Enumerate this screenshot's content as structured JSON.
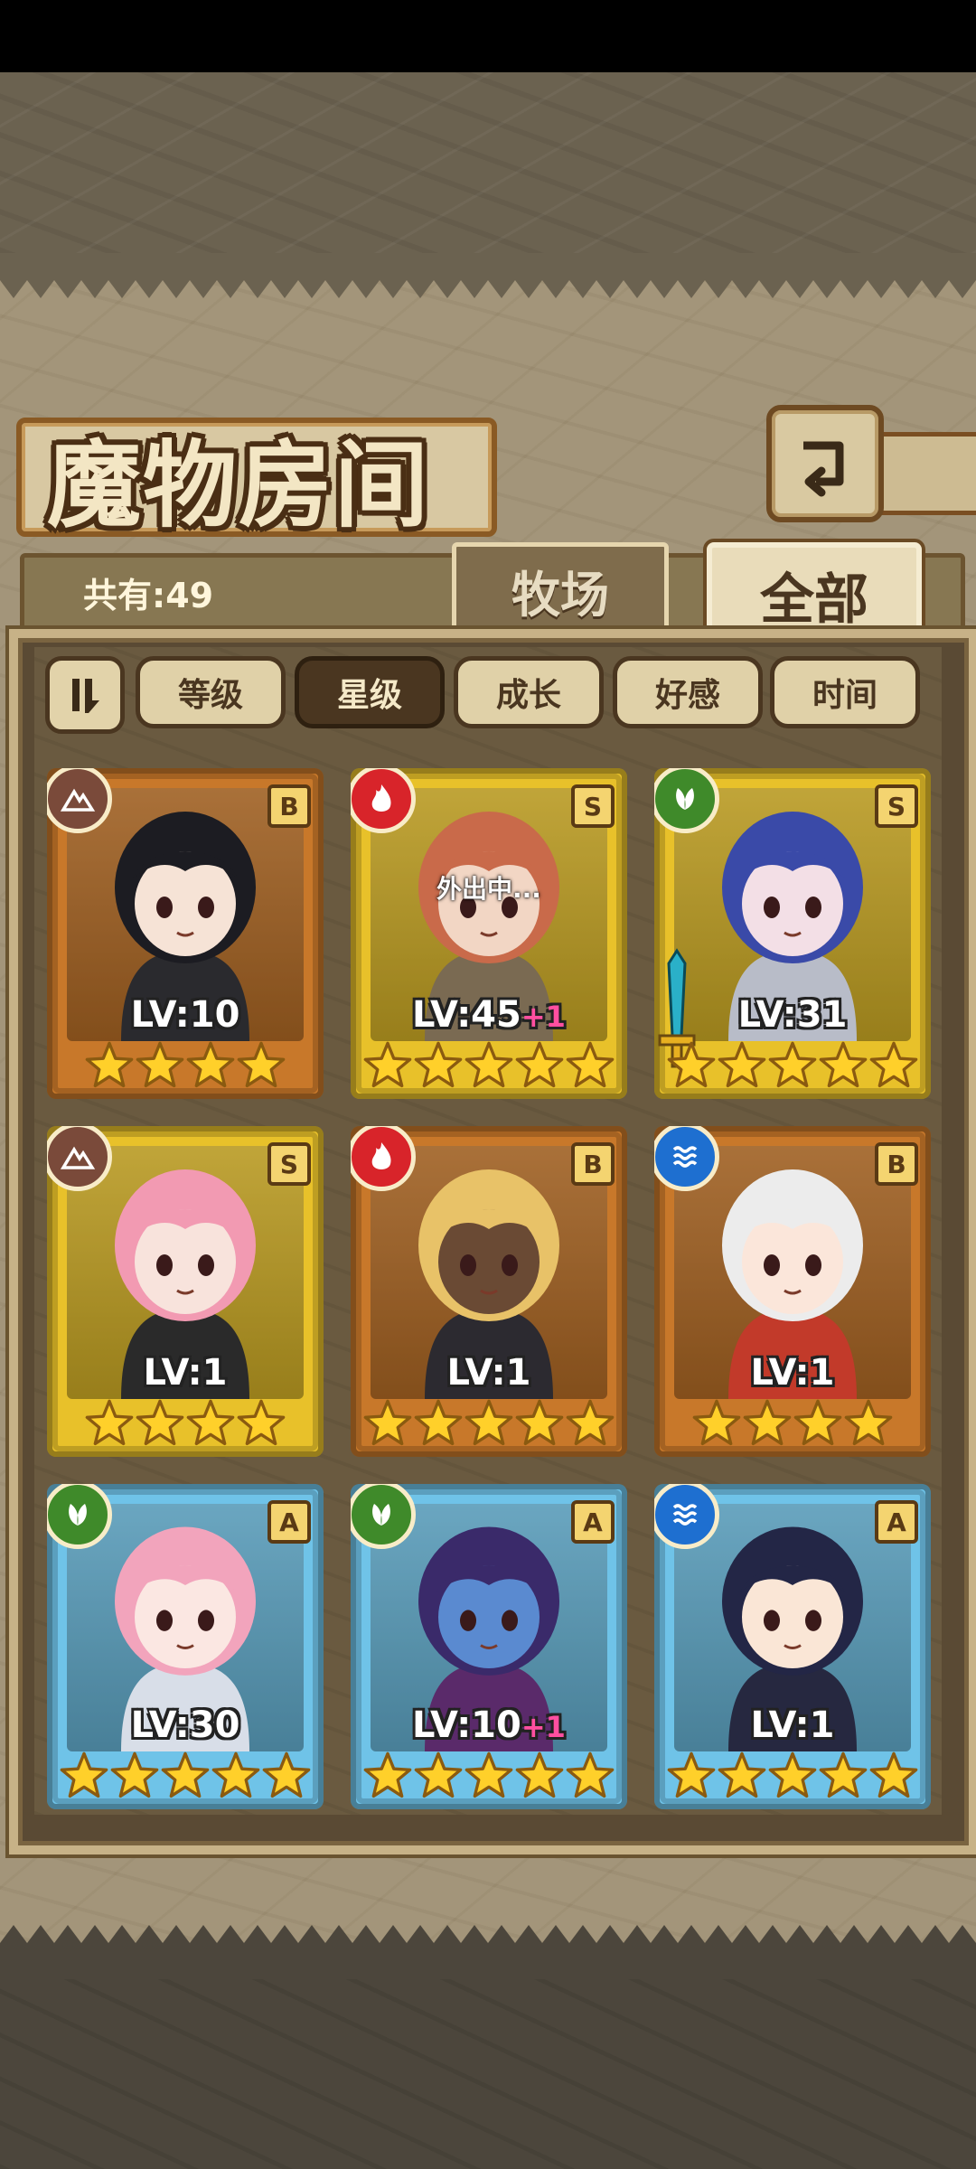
{
  "screen": {
    "title": "魔物房间",
    "count_label": "共有:49",
    "tabs": [
      {
        "label": "牧场",
        "active": false
      },
      {
        "label": "全部",
        "active": true
      }
    ],
    "sort_buttons": [
      {
        "label": "等级",
        "active": false
      },
      {
        "label": "星级",
        "active": true
      },
      {
        "label": "成长",
        "active": false
      },
      {
        "label": "好感",
        "active": false
      },
      {
        "label": "时间",
        "active": false
      }
    ]
  },
  "colors": {
    "frame_gold": "#e8c12a",
    "frame_bronze": "#c8782a",
    "frame_blue": "#6fc3e8",
    "attr_earth": "#7a4a3a",
    "attr_fire": "#d8242a",
    "attr_wood": "#3f8a2a",
    "attr_water": "#1e6fd0"
  },
  "monsters": [
    {
      "frame": "bronze",
      "attribute": "earth-icon",
      "rank": "B",
      "level": "LV:10",
      "bonus": "",
      "stars": 4,
      "status": "",
      "hair": "#1c1c22",
      "skin": "#f6e3d6",
      "outfit": "#2a2a2e"
    },
    {
      "frame": "gold",
      "attribute": "fire-icon",
      "rank": "S",
      "level": "LV:45",
      "bonus": "+1",
      "stars": 5,
      "status": "外出中...",
      "hair": "#c96a4a",
      "skin": "#f2d6c4",
      "outfit": "#7a6a52"
    },
    {
      "frame": "gold",
      "attribute": "wood-icon",
      "rank": "S",
      "level": "LV:31",
      "bonus": "",
      "stars": 5,
      "status": "",
      "hair": "#3a4aa8",
      "skin": "#f3dfe6",
      "outfit": "#b8bcc8"
    },
    {
      "frame": "gold",
      "attribute": "earth-icon",
      "rank": "S",
      "level": "LV:1",
      "bonus": "",
      "stars": 4,
      "status": "",
      "hair": "#f29ab2",
      "skin": "#f8e3dc",
      "outfit": "#2a2a2a"
    },
    {
      "frame": "bronze",
      "attribute": "fire-icon",
      "rank": "B",
      "level": "LV:1",
      "bonus": "",
      "stars": 5,
      "status": "",
      "hair": "#e8c268",
      "skin": "#6a4a34",
      "outfit": "#2c2a30"
    },
    {
      "frame": "bronze",
      "attribute": "water-icon",
      "rank": "B",
      "level": "LV:1",
      "bonus": "",
      "stars": 4,
      "status": "",
      "hair": "#ececec",
      "skin": "#fbe6da",
      "outfit": "#c23a2a"
    },
    {
      "frame": "blue",
      "attribute": "wood-icon",
      "rank": "A",
      "level": "LV:30",
      "bonus": "",
      "stars": 5,
      "status": "",
      "hair": "#f2a4bc",
      "skin": "#fbe7e2",
      "outfit": "#d8dee8"
    },
    {
      "frame": "blue",
      "attribute": "wood-icon",
      "rank": "A",
      "level": "LV:10",
      "bonus": "+1",
      "stars": 5,
      "status": "",
      "hair": "#3a2a6a",
      "skin": "#5a8ad0",
      "outfit": "#5a2a6a"
    },
    {
      "frame": "blue",
      "attribute": "water-icon",
      "rank": "A",
      "level": "LV:1",
      "bonus": "",
      "stars": 5,
      "status": "",
      "hair": "#232646",
      "skin": "#fae6d6",
      "outfit": "#262840"
    }
  ]
}
